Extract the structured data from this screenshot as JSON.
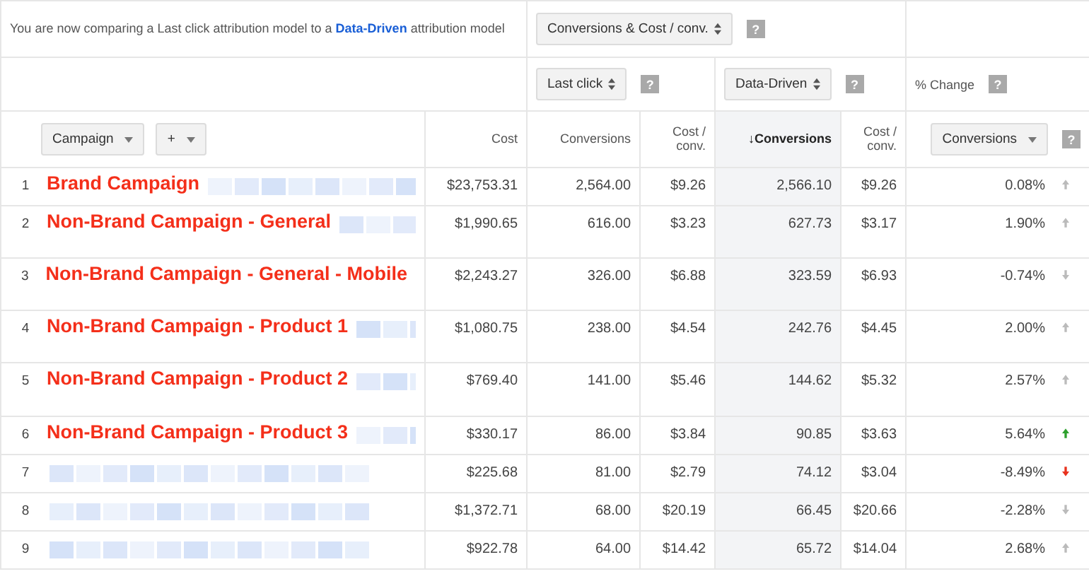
{
  "notice": {
    "text": "You are now comparing a Last click attribution model to a",
    "link": "Data-Driven",
    "suffix": "attribution model"
  },
  "metric_select": {
    "value": "Conversions & Cost / conv.",
    "help": "?"
  },
  "models": [
    {
      "value": "Last click",
      "help": "?"
    },
    {
      "value": "Data-Driven",
      "help": "?"
    }
  ],
  "change_header": {
    "label": "% Change",
    "help": "?"
  },
  "segment_buttons": [
    {
      "label": "Campaign",
      "kind": "dropdown"
    },
    {
      "label": "+",
      "kind": "dropdown"
    }
  ],
  "columns": [
    {
      "label": "Cost",
      "sorted": false
    },
    {
      "label": "Conversions",
      "sorted": false
    },
    {
      "label": "Cost / conv.",
      "sorted": false
    },
    {
      "label": "Conversions",
      "sorted": true,
      "sort_icon": "↓"
    },
    {
      "label": "Cost / conv.",
      "sorted": false
    }
  ],
  "change_select": {
    "value": "Conversions",
    "help": "?"
  },
  "rows": [
    {
      "index": "1",
      "annotation": "Brand Campaign",
      "cells": [
        "$23,753.31",
        "2,564.00",
        "$9.26",
        "2,566.10",
        "$9.26"
      ],
      "change": "0.08%",
      "rising": true,
      "significant": false
    },
    {
      "index": "2",
      "annotation": "Non-Brand Campaign - General",
      "cells": [
        "$1,990.65",
        "616.00",
        "$3.23",
        "627.73",
        "$3.17"
      ],
      "change": "1.90%",
      "rising": true,
      "significant": false
    },
    {
      "index": "3",
      "annotation": "Non-Brand Campaign - General - Mobile",
      "cells": [
        "$2,243.27",
        "326.00",
        "$6.88",
        "323.59",
        "$6.93"
      ],
      "change": "-0.74%",
      "rising": false,
      "significant": false
    },
    {
      "index": "4",
      "annotation": "Non-Brand Campaign - Product 1",
      "cells": [
        "$1,080.75",
        "238.00",
        "$4.54",
        "242.76",
        "$4.45"
      ],
      "change": "2.00%",
      "rising": true,
      "significant": false
    },
    {
      "index": "5",
      "annotation": "Non-Brand Campaign - Product 2",
      "cells": [
        "$769.40",
        "141.00",
        "$5.46",
        "144.62",
        "$5.32"
      ],
      "change": "2.57%",
      "rising": true,
      "significant": false
    },
    {
      "index": "6",
      "annotation": "Non-Brand Campaign - Product 3",
      "cells": [
        "$330.17",
        "86.00",
        "$3.84",
        "90.85",
        "$3.63"
      ],
      "change": "5.64%",
      "rising": true,
      "significant": true
    },
    {
      "index": "7",
      "cells": [
        "$225.68",
        "81.00",
        "$2.79",
        "74.12",
        "$3.04"
      ],
      "change": "-8.49%",
      "rising": false,
      "significant": true
    },
    {
      "index": "8",
      "cells": [
        "$1,372.71",
        "68.00",
        "$20.19",
        "66.45",
        "$20.66"
      ],
      "change": "-2.28%",
      "rising": false,
      "significant": false
    },
    {
      "index": "9",
      "cells": [
        "$922.78",
        "64.00",
        "$14.42",
        "65.72",
        "$14.04"
      ],
      "change": "2.68%",
      "rising": true,
      "significant": false
    }
  ]
}
